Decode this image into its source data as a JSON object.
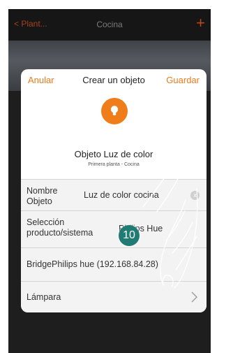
{
  "topbar": {
    "back_label": "< Plant...",
    "title": "Cocina",
    "add_icon": "+"
  },
  "modal": {
    "cancel_label": "Anular",
    "title": "Crear un objeto",
    "save_label": "Guardar",
    "object_icon": "lightbulb-icon",
    "object_title": "Objeto Luz de color",
    "object_location": "Primera planta - Cocina",
    "fields": [
      {
        "label_line1": "Nombre",
        "label_line2": "Objeto",
        "value": "Luz de color cocina",
        "clear": "x"
      },
      {
        "label_line1": "Selección",
        "label_line2": "producto/sistema",
        "value": "Philips Hue"
      },
      {
        "label": "Bridge",
        "value": "Philips hue (192.168.84.28)"
      },
      {
        "label": "Lámpara",
        "chevron": "chevron-right-icon"
      }
    ]
  },
  "step_badge": "10",
  "colors": {
    "accent": "#ee7a1a",
    "badge": "#1f7b73",
    "dark": "#1b1b1b"
  }
}
